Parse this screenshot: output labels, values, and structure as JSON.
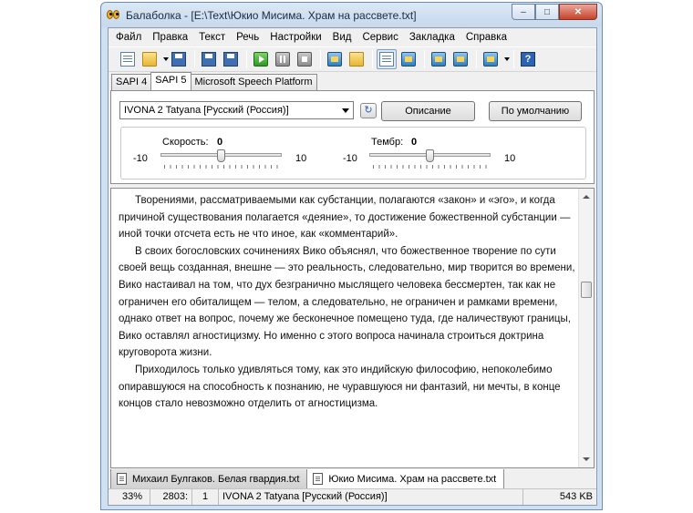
{
  "window": {
    "title": "Балаболка - [E:\\Text\\Юкио Мисима. Храм на рассвете.txt]",
    "buttons": {
      "minimize": "–",
      "maximize": "□",
      "close": "✕"
    }
  },
  "menu": [
    "Файл",
    "Правка",
    "Текст",
    "Речь",
    "Настройки",
    "Вид",
    "Сервис",
    "Закладка",
    "Справка"
  ],
  "toolbar": {
    "icons": [
      "new-document-icon",
      "open-folder-icon",
      "save-icon",
      "convert-icon",
      "convert-batch-icon",
      "play-icon",
      "pause-icon",
      "stop-icon",
      "save-audio-icon",
      "save-audio-folder-icon",
      "text-panel-icon",
      "voice-panel-icon",
      "record-icon",
      "record-folder-icon",
      "split-icon",
      "help-icon"
    ],
    "help_glyph": "?"
  },
  "engine_tabs": [
    "SAPI 4",
    "SAPI 5",
    "Microsoft Speech Platform"
  ],
  "active_engine_tab": 1,
  "voice": {
    "selected": "IVONA 2 Tatyana [Русский (Россия)]",
    "describe_button": "Описание",
    "default_button": "По умолчанию",
    "refresh_glyph": "↻"
  },
  "rate": {
    "label": "Скорость:",
    "value": "0",
    "min": "-10",
    "max": "10",
    "level": 0.5
  },
  "pitch": {
    "label": "Тембр:",
    "value": "0",
    "min": "-10",
    "max": "10",
    "level": 0.5
  },
  "text": {
    "paragraphs": [
      "Творениями, рассматриваемыми как субстанции, полагаются «закон» и «эго», и когда причиной существования полагается «деяние», то достижение божественной субстанции — иной точки отсчета есть не что иное, как «комментарий».",
      "В своих богословских сочинениях Вико объяснял, что божественное творение по сути своей вещь созданная, внешне — это реальность, следовательно, мир творится во времени, Вико настаивал на том, что дух безгранично мыслящего человека бессмертен, так как не ограничен его обиталищем — телом, а следовательно, не ограничен и рамками времени, однако ответ на вопрос, почему же бесконечное помещено туда, где наличествуют границы, Вико оставлял агностицизму. Но именно с этого вопроса начинала строиться доктрина круговорота жизни.",
      "Приходилось только удивляться тому, как это индийскую философию, непоколебимо опиравшуюся на способность к познанию, не чуравшуюся ни фантазий, ни мечты, в конце концов стало невозможно отделить от агностицизма."
    ],
    "scroll_position": 0.33
  },
  "document_tabs": [
    "Михаил Булгаков. Белая гвардия.txt",
    "Юкио Мисима. Храм на рассвете.txt"
  ],
  "active_document_tab": 1,
  "status": {
    "progress": "33%",
    "position": "2803:",
    "line": "1",
    "voice": "IVONA 2 Tatyana [Русский (Россия)]",
    "size": "543 KB"
  }
}
